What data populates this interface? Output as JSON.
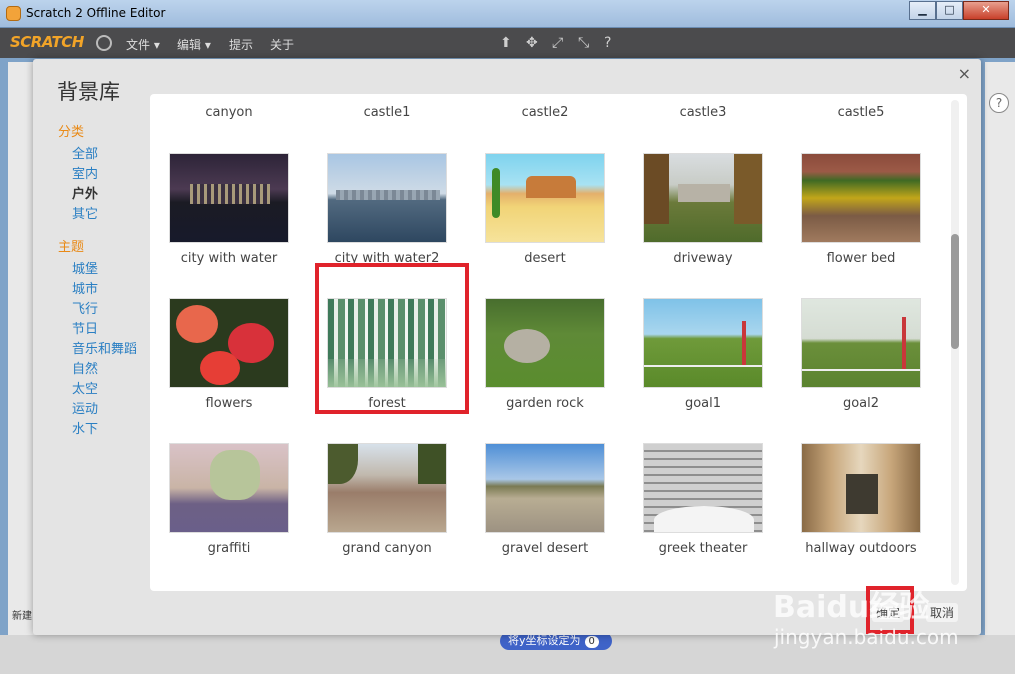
{
  "window": {
    "title": "Scratch 2 Offline Editor",
    "minimize": "▁",
    "maximize": "□",
    "close": "✕"
  },
  "menubar": {
    "logo": "SCRATCH",
    "items": [
      "文件 ▾",
      "编辑 ▾",
      "提示",
      "关于"
    ],
    "tools": [
      "⬆",
      "✥",
      "⤢",
      "⤡",
      "?"
    ]
  },
  "editor": {
    "new_label": "新建",
    "block_label": "将y坐标设定为",
    "block_value": "0",
    "help": "?"
  },
  "dialog": {
    "title": "背景库",
    "close": "×",
    "sidebar": {
      "category_heading": "分类",
      "categories": [
        "全部",
        "室内",
        "户外",
        "其它"
      ],
      "theme_heading": "主题",
      "themes": [
        "城堡",
        "城市",
        "飞行",
        "节日",
        "音乐和舞蹈",
        "自然",
        "太空",
        "运动",
        "水下"
      ]
    },
    "top_row_labels": [
      "canyon",
      "castle1",
      "castle2",
      "castle3",
      "castle5"
    ],
    "rows": [
      [
        "city with water",
        "city with water2",
        "desert",
        "driveway",
        "flower bed"
      ],
      [
        "flowers",
        "forest",
        "garden rock",
        "goal1",
        "goal2"
      ],
      [
        "graffiti",
        "grand canyon",
        "gravel desert",
        "greek theater",
        "hallway outdoors"
      ]
    ],
    "selected": "forest",
    "ok_label": "确定",
    "cancel_label": "取消"
  },
  "watermark": {
    "text": "Baidu经验",
    "url": "jingyan.baidu.com"
  },
  "colors": {
    "accent_orange": "#e98a17",
    "link_blue": "#2a7fc3",
    "highlight_red": "#e0232b",
    "menubar": "#4b4b4d"
  }
}
